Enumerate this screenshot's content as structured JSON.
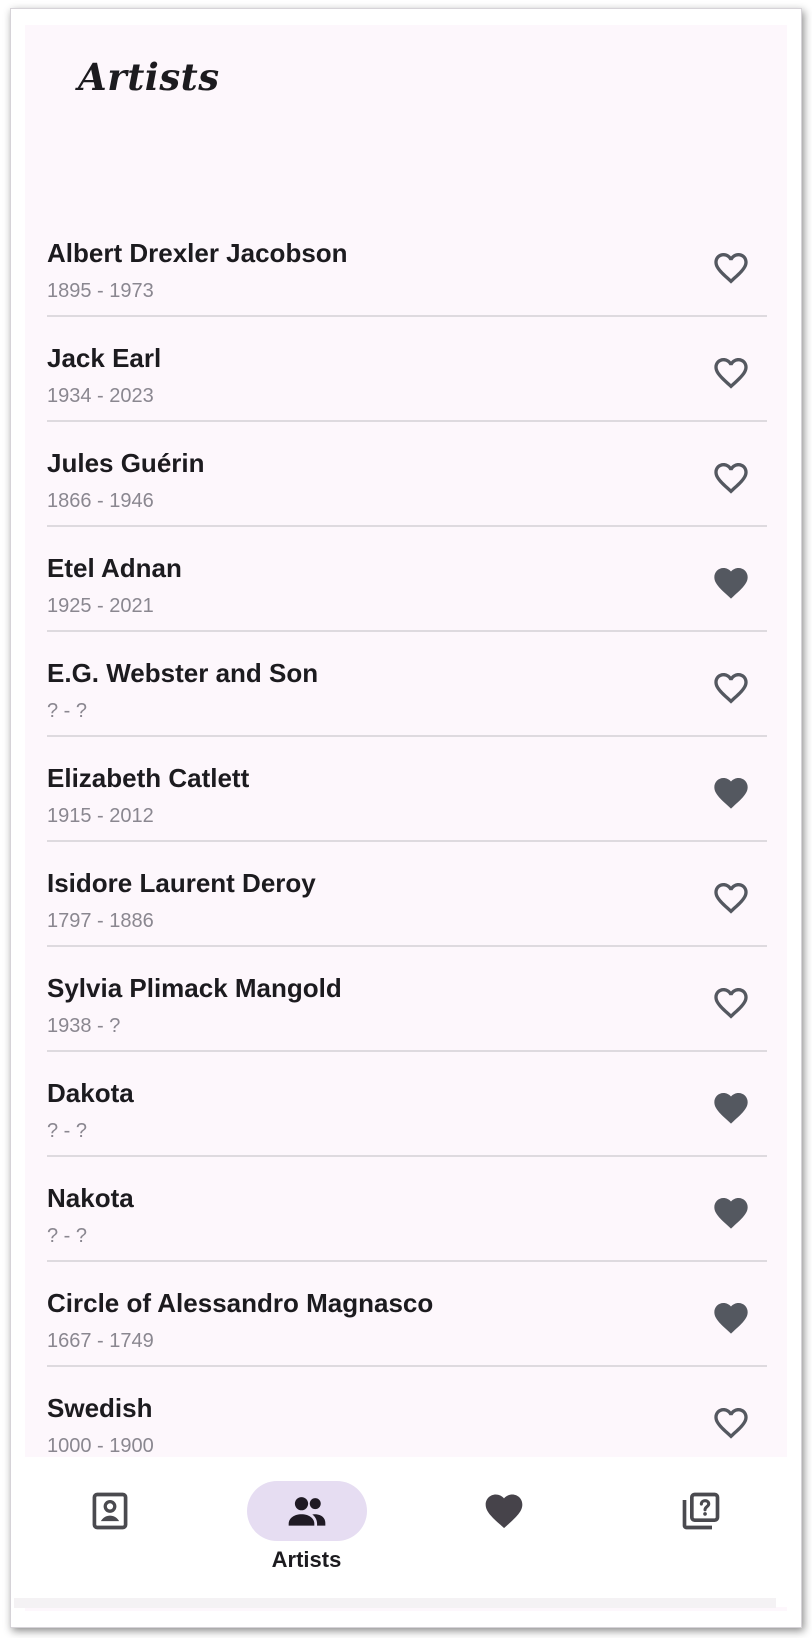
{
  "header": {
    "title": "Artists"
  },
  "artists": [
    {
      "name": "Albert Drexler Jacobson",
      "dates": "1895 - 1973",
      "favorite": false
    },
    {
      "name": "Jack Earl",
      "dates": "1934 - 2023",
      "favorite": false
    },
    {
      "name": "Jules Guérin",
      "dates": "1866 - 1946",
      "favorite": false
    },
    {
      "name": "Etel Adnan",
      "dates": "1925 - 2021",
      "favorite": true
    },
    {
      "name": "E.G. Webster and Son",
      "dates": "? - ?",
      "favorite": false
    },
    {
      "name": "Elizabeth Catlett",
      "dates": "1915 - 2012",
      "favorite": true
    },
    {
      "name": "Isidore Laurent Deroy",
      "dates": "1797 - 1886",
      "favorite": false
    },
    {
      "name": "Sylvia Plimack Mangold",
      "dates": "1938 - ?",
      "favorite": false
    },
    {
      "name": "Dakota",
      "dates": "? - ?",
      "favorite": true
    },
    {
      "name": "Nakota",
      "dates": "? - ?",
      "favorite": true
    },
    {
      "name": "Circle of Alessandro Magnasco",
      "dates": "1667 - 1749",
      "favorite": true
    },
    {
      "name": "Swedish",
      "dates": "1000 - 1900",
      "favorite": false
    }
  ],
  "nav": {
    "items": [
      {
        "id": "artworks",
        "icon": "artwork-frame-icon",
        "label": "",
        "active": false
      },
      {
        "id": "artists",
        "icon": "people-icon",
        "label": "Artists",
        "active": true
      },
      {
        "id": "favorites",
        "icon": "heart-filled-icon",
        "label": "",
        "active": false
      },
      {
        "id": "quiz",
        "icon": "quiz-question-icon",
        "label": "",
        "active": false
      }
    ]
  },
  "colors": {
    "background": "#fdf7fc",
    "heart": "#545860",
    "active_pill": "#e6ddf2",
    "divider": "#dedadf",
    "dates_text": "#8a8790"
  }
}
